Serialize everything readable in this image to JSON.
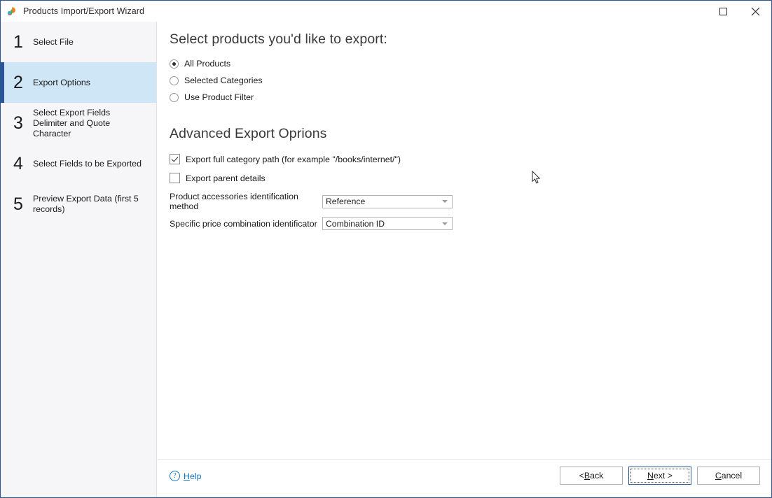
{
  "window": {
    "title": "Products Import/Export Wizard",
    "app_icon": "leaf-icon",
    "maximize_label": "Maximize",
    "close_label": "Close",
    "accent_color": "#2a5699",
    "active_step_bg": "#cfe6f7"
  },
  "sidebar": {
    "items": [
      {
        "number": "1",
        "label": "Select File",
        "active": false
      },
      {
        "number": "2",
        "label": "Export Options",
        "active": true
      },
      {
        "number": "3",
        "label": "Select Export Fields Delimiter and Quote Character",
        "active": false
      },
      {
        "number": "4",
        "label": "Select Fields to be Exported",
        "active": false
      },
      {
        "number": "5",
        "label": "Preview Export Data (first 5 records)",
        "active": false
      }
    ]
  },
  "main": {
    "heading": "Select products you'd like to export:",
    "radios": [
      {
        "label": "All Products",
        "selected": true
      },
      {
        "label": "Selected Categories",
        "selected": false
      },
      {
        "label": "Use Product Filter",
        "selected": false
      }
    ],
    "advanced_heading": "Advanced Export Oprions",
    "checkboxes": [
      {
        "label": "Export full category path (for example \"/books/internet/\")",
        "checked": true
      },
      {
        "label": "Export parent details",
        "checked": false
      }
    ],
    "dropdowns": [
      {
        "label": "Product accessories identification method",
        "value": "Reference"
      },
      {
        "label": "Specific price combination identificator",
        "value": "Combination ID"
      }
    ]
  },
  "footer": {
    "help_label_prefix": "",
    "help_accel": "H",
    "help_label_rest": "elp",
    "help_icon": "question-circle-icon",
    "buttons": [
      {
        "name": "back",
        "prefix": "< ",
        "accel": "B",
        "rest": "ack",
        "default": false
      },
      {
        "name": "next",
        "prefix": "",
        "accel": "N",
        "rest": "ext >",
        "default": true
      },
      {
        "name": "cancel",
        "prefix": "",
        "accel": "C",
        "rest": "ancel",
        "default": false
      }
    ]
  }
}
